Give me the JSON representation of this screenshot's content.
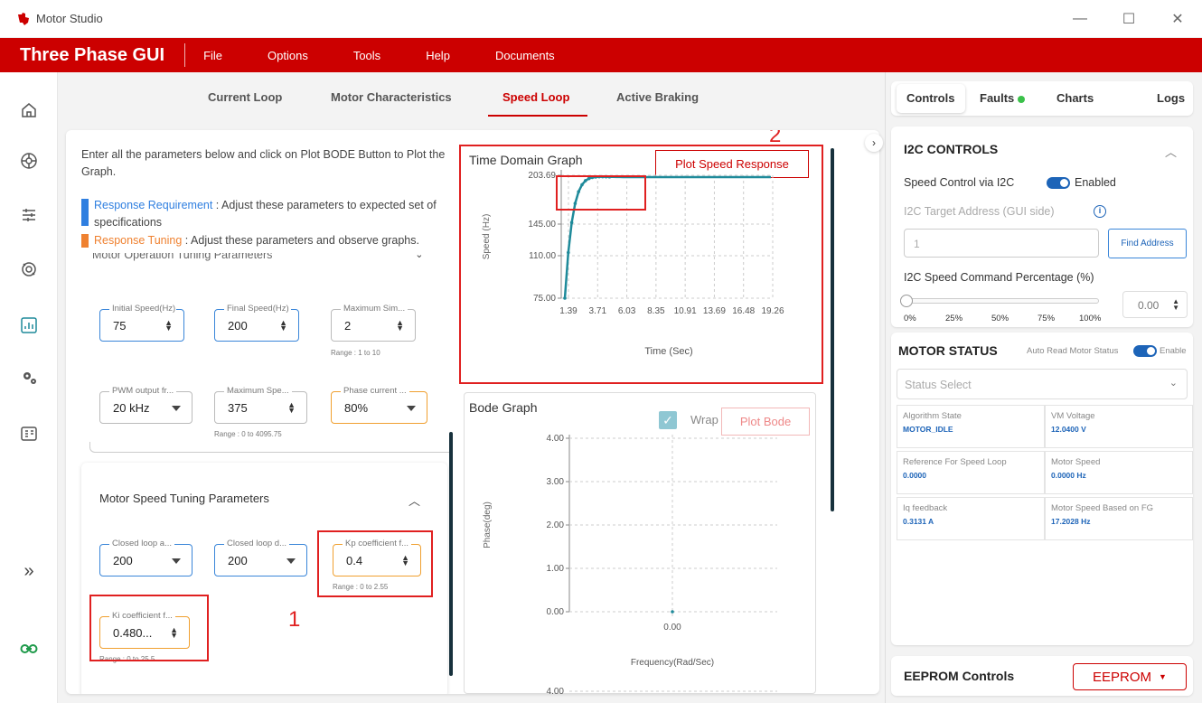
{
  "window": {
    "title": "Motor Studio",
    "controls": [
      "—",
      "☐",
      "✕"
    ]
  },
  "menubar": {
    "app_name": "Three Phase GUI",
    "items": [
      "File",
      "Options",
      "Tools",
      "Help",
      "Documents"
    ]
  },
  "tabs": {
    "items": [
      "Current Loop",
      "Motor Characteristics",
      "Speed Loop",
      "Active Braking"
    ],
    "active": "Speed Loop"
  },
  "instructions": {
    "intro": "Enter all the parameters below and click on Plot BODE Button to Plot the Graph.",
    "req_highlight": "Response Requirement",
    "req_text": " : Adjust these parameters to expected set of specifications",
    "tun_highlight": "Response Tuning",
    "tun_text": " : Adjust these parameters and observe graphs."
  },
  "operation_section": {
    "title": "Motor Operation Tuning Parameters",
    "fields": [
      {
        "label": "Initial Speed(Hz)",
        "value": "75",
        "kind": "spin"
      },
      {
        "label": "Final Speed(Hz)",
        "value": "200",
        "kind": "spin"
      },
      {
        "label": "Maximum Sim...",
        "value": "2",
        "kind": "spin",
        "range": "Range : 1 to 10"
      },
      {
        "label": "PWM output fr...",
        "value": "20 kHz",
        "kind": "select"
      },
      {
        "label": "Maximum Spe...",
        "value": "375",
        "kind": "spin",
        "range": "Range : 0 to 4095.75"
      },
      {
        "label": "Phase current ...",
        "value": "80%",
        "kind": "select"
      }
    ]
  },
  "speed_section": {
    "title": "Motor Speed Tuning Parameters",
    "fields": [
      {
        "label": "Closed loop a...",
        "value": "200",
        "kind": "select"
      },
      {
        "label": "Closed loop d...",
        "value": "200",
        "kind": "select"
      },
      {
        "label": "Kp coefficient f...",
        "value": "0.4",
        "kind": "spin",
        "range": "Range : 0 to 2.55"
      },
      {
        "label": "Ki coefficient f...",
        "value": "0.480...",
        "kind": "spin",
        "range": "Range : 0 to 25.5"
      }
    ]
  },
  "annotations": {
    "one": "1",
    "two": "2"
  },
  "time_graph": {
    "title": "Time Domain Graph",
    "button": "Plot Speed Response",
    "ylabel": "Speed (Hz)",
    "xlabel": "Time (Sec)",
    "yticks": [
      "203.69",
      "145.00",
      "110.00",
      "75.00"
    ],
    "xticks": [
      "1.39",
      "3.71",
      "6.03",
      "8.35",
      "10.91",
      "13.69",
      "16.48",
      "19.26"
    ]
  },
  "bode_graph": {
    "title": "Bode Graph",
    "wrap_label": "Wrap",
    "button": "Plot Bode",
    "ylabel": "Phase(deg)",
    "xlabel": "Frequency(Rad/Sec)",
    "yticks": [
      "4.00",
      "3.00",
      "2.00",
      "1.00",
      "0.00"
    ],
    "xtick": "0.00",
    "cut_tick": "4.00"
  },
  "right_tabs": {
    "items": [
      "Controls",
      "Faults",
      "Charts",
      "Logs"
    ],
    "active": "Controls"
  },
  "i2c": {
    "title": "I2C CONTROLS",
    "speed_label": "Speed Control via I2C",
    "toggle_label": "Enabled",
    "address_label": "I2C Target Address (GUI side)",
    "address_value": "1",
    "find_button": "Find Address",
    "percent_label": "I2C Speed Command Percentage (%)",
    "percent_value": "0.00",
    "slider_ticks": [
      "0%",
      "25%",
      "50%",
      "75%",
      "100%"
    ],
    "slider_value": 0
  },
  "motor_status": {
    "title": "MOTOR STATUS",
    "auto_read_label": "Auto Read Motor Status",
    "toggle_label": "Enable",
    "select_placeholder": "Status Select",
    "cells": [
      {
        "label": "Algorithm State",
        "value": "MOTOR_IDLE"
      },
      {
        "label": "VM Voltage",
        "value": "12.0400 V"
      },
      {
        "label": "Reference For Speed Loop",
        "value": "0.0000"
      },
      {
        "label": "Motor Speed",
        "value": "0.0000 Hz"
      },
      {
        "label": "Iq feedback",
        "value": "0.3131 A"
      },
      {
        "label": "Motor Speed Based on FG",
        "value": "17.2028 Hz"
      }
    ]
  },
  "eeprom": {
    "title": "EEPROM Controls",
    "button": "EEPROM"
  },
  "colors": {
    "brand_red": "#cc0000",
    "requirement_blue": "#2f7fe0",
    "tuning_orange": "#ef8130",
    "status_green": "#3bc14a",
    "plot_teal": "#1e8a9a"
  }
}
